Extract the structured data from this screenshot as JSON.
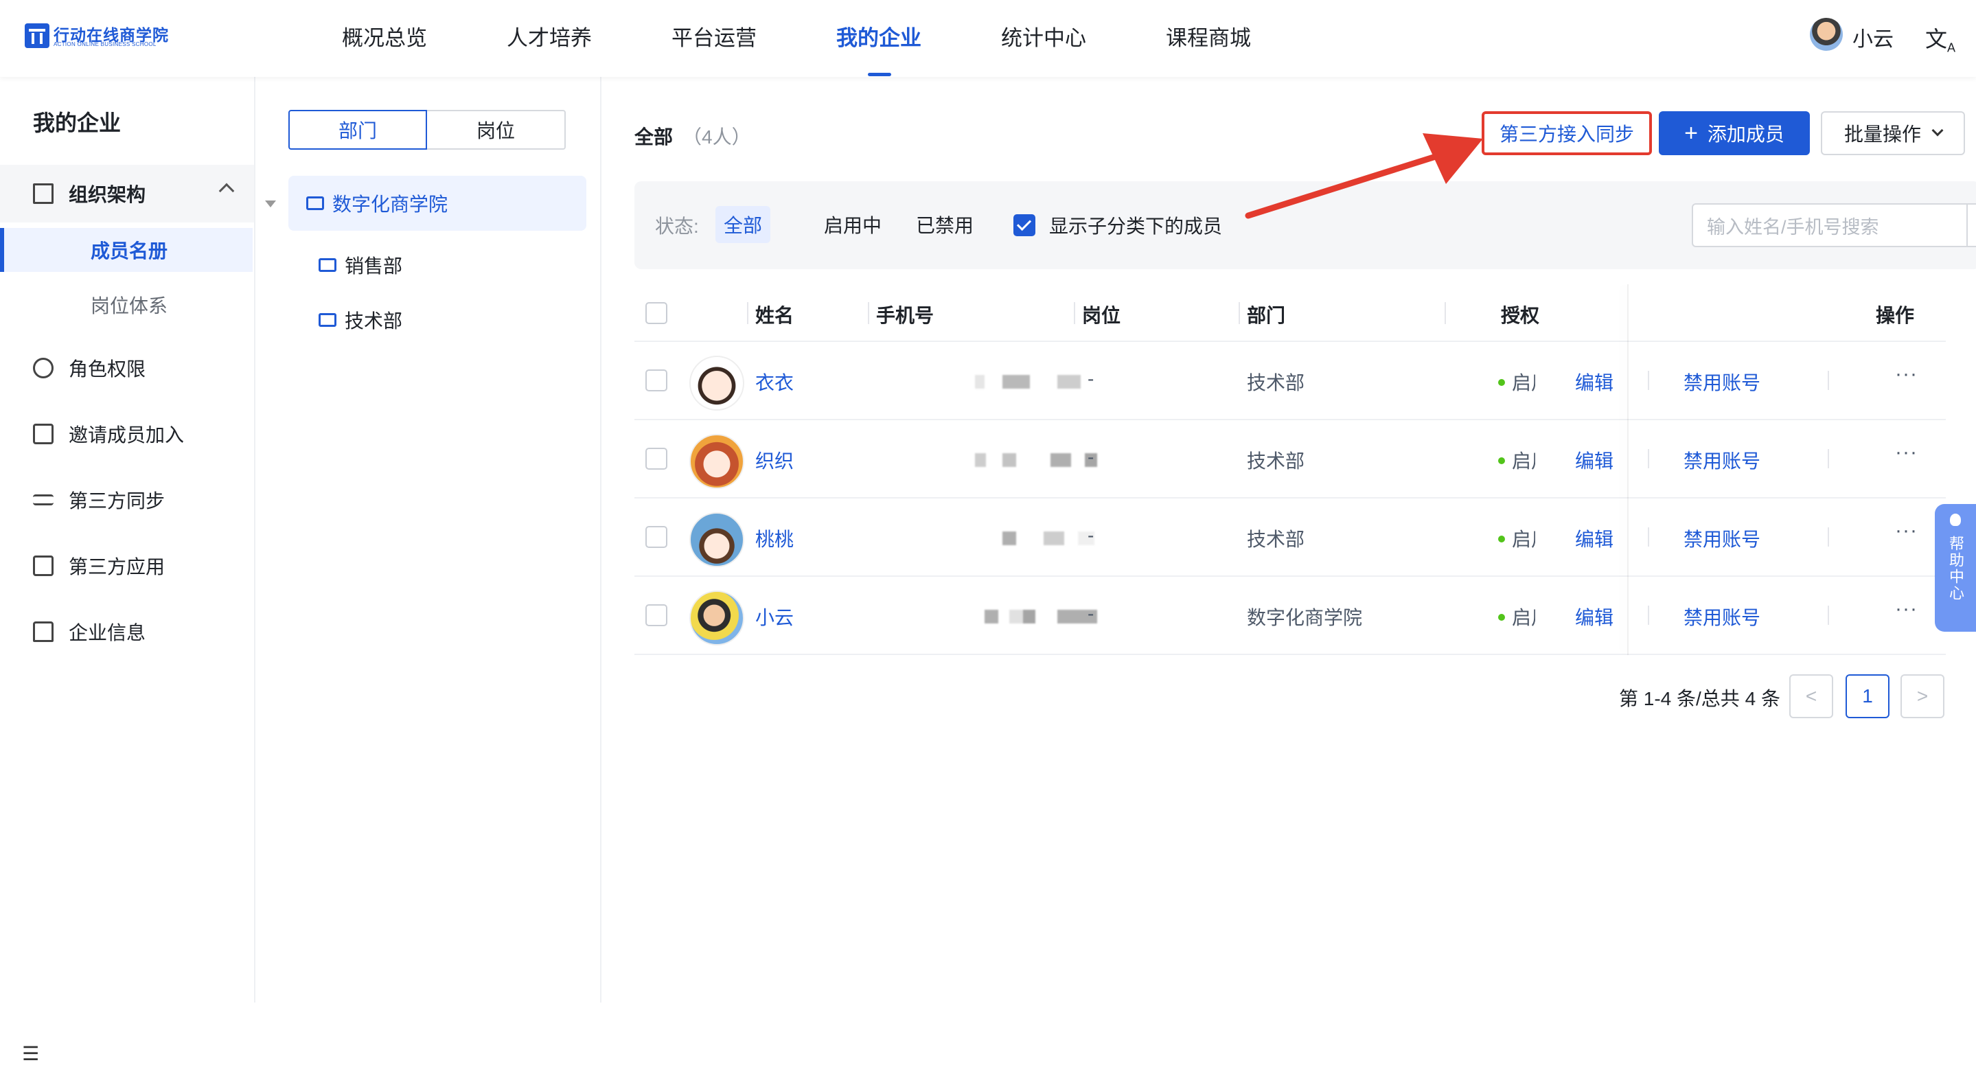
{
  "brand": {
    "name_cn": "行动在线商学院",
    "name_en": "ACTION ONLINE BUSINESS SCHOOL",
    "accent": "#1f5ad6"
  },
  "top_nav": {
    "items": [
      "概况总览",
      "人才培养",
      "平台运营",
      "我的企业",
      "统计中心",
      "课程商城"
    ],
    "active": "我的企业",
    "user_name": "小云",
    "translate_icon": "translate-icon"
  },
  "sidebar": {
    "title": "我的企业",
    "group": "组织架构",
    "sub_items": [
      "成员名册",
      "岗位体系"
    ],
    "active_sub": "成员名册",
    "items": [
      "角色权限",
      "邀请成员加入",
      "第三方同步",
      "第三方应用",
      "企业信息"
    ]
  },
  "tree": {
    "tabs": [
      "部门",
      "岗位"
    ],
    "active_tab": "部门",
    "root": "数字化商学院",
    "children": [
      "销售部",
      "技术部"
    ]
  },
  "main": {
    "title": "全部",
    "count": "（4人）",
    "sync_button": "第三方接入同步",
    "add_button": "添加成员",
    "batch_button": "批量操作",
    "filter": {
      "label": "状态:",
      "options": [
        "全部",
        "启用中",
        "已禁用"
      ],
      "active": "全部",
      "checkbox_label": "显示子分类下的成员",
      "checkbox_checked": true,
      "search_placeholder": "输入姓名/手机号搜索"
    },
    "columns": [
      "姓名",
      "手机号",
      "岗位",
      "部门",
      "授权",
      "操作"
    ],
    "rows": [
      {
        "name": "衣衣",
        "position": "-",
        "dept": "技术部",
        "status": "启用中",
        "edit": "编辑",
        "disable": "禁用账号",
        "more": "···"
      },
      {
        "name": "织织",
        "position": "-",
        "dept": "技术部",
        "status": "启用中",
        "edit": "编辑",
        "disable": "禁用账号",
        "more": "···"
      },
      {
        "name": "桃桃",
        "position": "-",
        "dept": "技术部",
        "status": "启用中",
        "edit": "编辑",
        "disable": "禁用账号",
        "more": "···"
      },
      {
        "name": "小云",
        "position": "-",
        "dept": "数字化商学院",
        "status": "启用中",
        "edit": "编辑",
        "disable": "禁用账号",
        "more": "···"
      }
    ],
    "pagination": {
      "summary": "第 1-4 条/总共 4 条",
      "current": "1",
      "prev": "<",
      "next": ">"
    }
  },
  "help": {
    "label": "帮助中心"
  },
  "annotation": {
    "arrow_color": "#e33b2e"
  }
}
